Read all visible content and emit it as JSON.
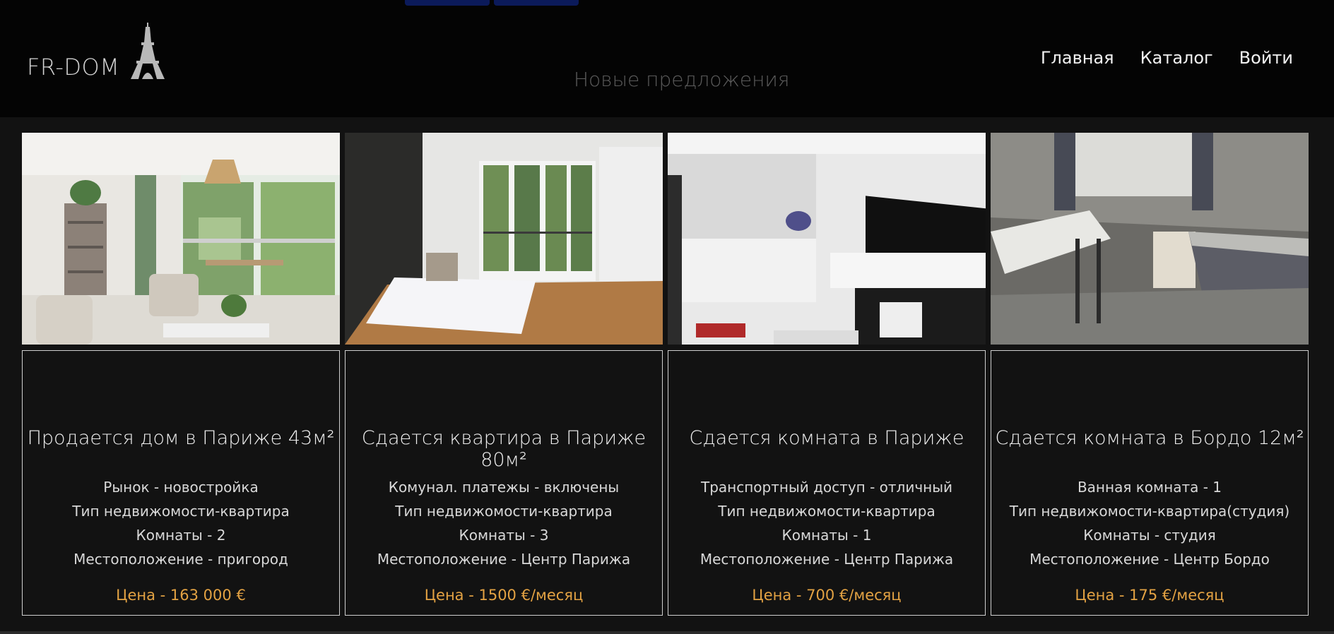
{
  "header": {
    "logo_text": "FR-DOM",
    "logo_icon": "eiffel-tower-icon",
    "section_title": "Новые предложения",
    "nav": [
      "Главная",
      "Каталог",
      "Войти"
    ]
  },
  "listings": [
    {
      "title": "Продается дом в Париже 43м²",
      "props": [
        "Рынок - новостройка",
        "Тип недвижомости-квартира",
        "Комнаты - 2",
        "Местоположение - пригород"
      ],
      "price": "Цена - 163 000 €"
    },
    {
      "title": "Сдается квартира в Париже 80м²",
      "props": [
        "Комунал. платежы - включены",
        "Тип недвижомости-квартира",
        "Комнаты - 3",
        "Местоположение - Центр Парижа"
      ],
      "price": "Цена - 1500 €/месяц"
    },
    {
      "title": "Сдается комната в Париже",
      "props": [
        "Транспортный доступ - отличный",
        "Тип недвижомости-квартира",
        "Комнаты - 1",
        "Местоположение - Центр Парижа"
      ],
      "price": "Цена - 700 €/месяц"
    },
    {
      "title": "Сдается комната в Бордо 12м²",
      "props": [
        "Ванная комната - 1",
        "Тип недвижомости-квартира(студия)",
        "Комнаты - студия",
        "Местоположение - Центр Бордо"
      ],
      "price": "Цена - 175 €/месяц"
    }
  ],
  "colors": {
    "price": "#e3a243",
    "background": "#121212",
    "header": "#040404"
  }
}
